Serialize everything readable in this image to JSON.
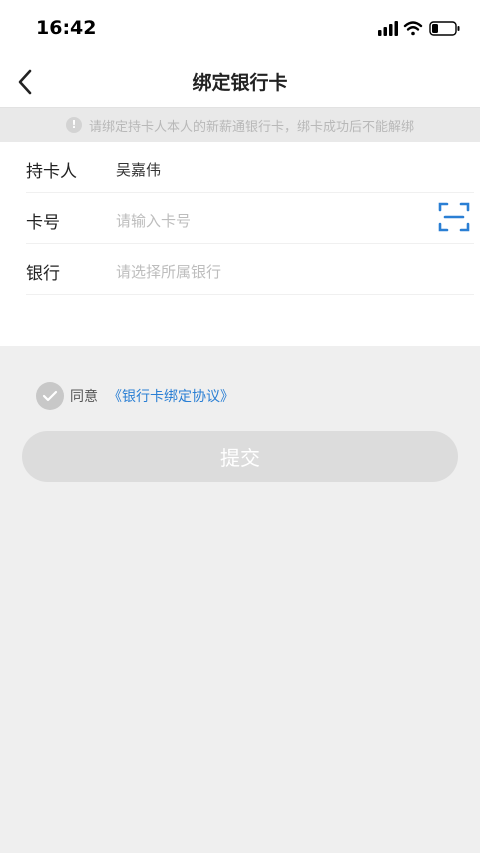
{
  "status_bar": {
    "time": "16:42"
  },
  "nav": {
    "title": "绑定银行卡"
  },
  "notice": {
    "icon_text": "!",
    "text": "请绑定持卡人本人的新薪通银行卡，绑卡成功后不能解绑"
  },
  "form": {
    "holder": {
      "label": "持卡人",
      "value": "吴嘉伟"
    },
    "card_number": {
      "label": "卡号",
      "placeholder": "请输入卡号"
    },
    "bank": {
      "label": "银行",
      "placeholder": "请选择所属银行"
    }
  },
  "agreement": {
    "text": "同意",
    "link": "《银行卡绑定协议》"
  },
  "submit": {
    "label": "提交"
  },
  "colors": {
    "accent": "#2a7fd4",
    "background": "#efefef",
    "button_disabled": "#dcdcdc"
  }
}
